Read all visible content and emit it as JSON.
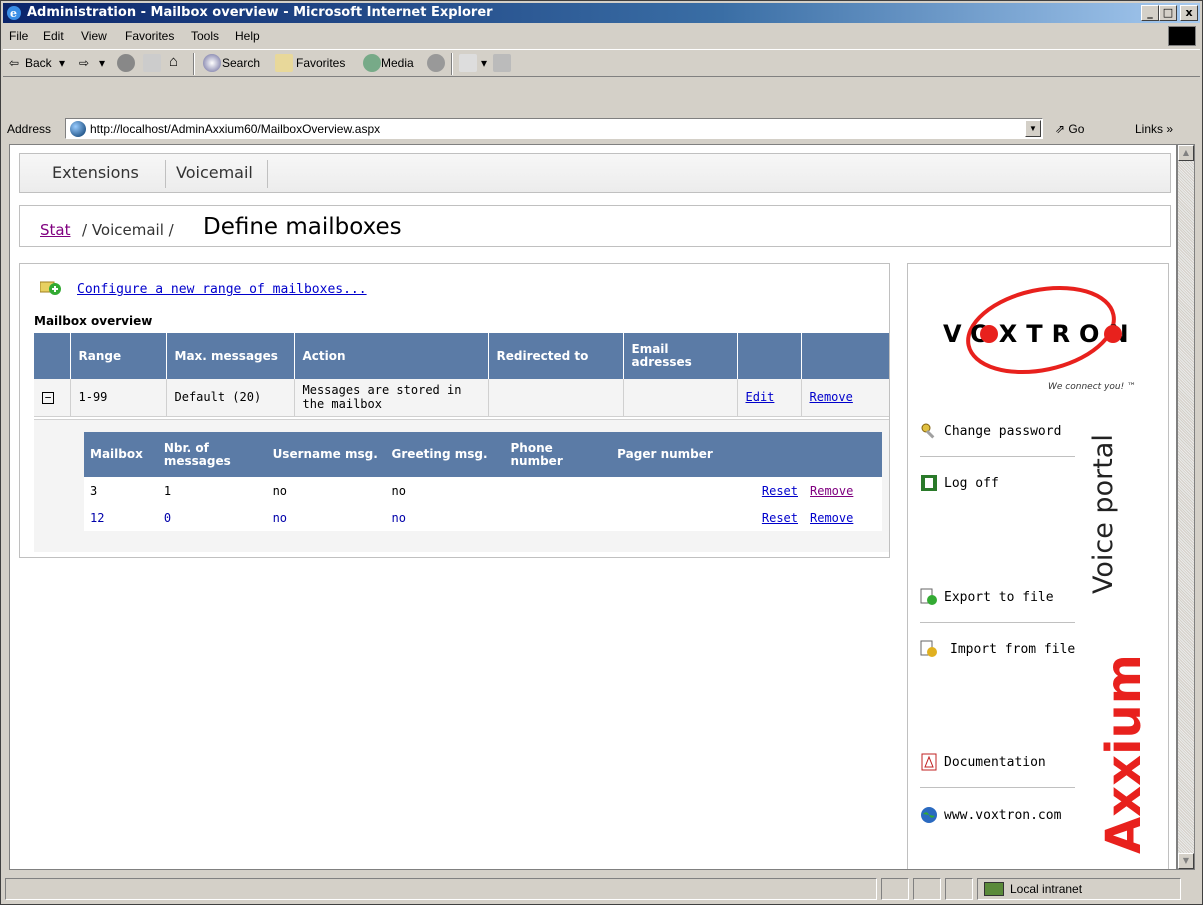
{
  "window": {
    "title": "Administration - Mailbox overview - Microsoft Internet Explorer",
    "min_label": "_",
    "max_label": "□",
    "close_label": "x"
  },
  "menu": [
    "File",
    "Edit",
    "View",
    "Favorites",
    "Tools",
    "Help"
  ],
  "toolbar": {
    "back": "Back",
    "search": "Search",
    "favorites": "Favorites",
    "media": "Media"
  },
  "address": {
    "label": "Address",
    "url": "http://localhost/AdminAxxium60/MailboxOverview.aspx",
    "go": "Go",
    "links": "Links »"
  },
  "tabs": [
    "Extensions",
    "Voicemail"
  ],
  "breadcrumb": {
    "start": "Stat",
    "middle": "/ Voicemail /",
    "title": "Define mailboxes"
  },
  "configure_link": "Configure a new range of mailboxes...",
  "overview_title": "Mailbox overview",
  "outer_table": {
    "headers": [
      "Range",
      "Max. messages",
      "Action",
      "Redirected to",
      "Email adresses"
    ],
    "row": {
      "toggle": "−",
      "range": "1-99",
      "max": "Default (20)",
      "action": "Messages are stored in the mailbox",
      "redirected": "",
      "email": "",
      "edit": "Edit",
      "remove": "Remove"
    }
  },
  "inner_table": {
    "headers": [
      "Mailbox",
      "Nbr. of messages",
      "Username msg.",
      "Greeting msg.",
      "Phone number",
      "Pager number"
    ],
    "rows": [
      {
        "mailbox": "3",
        "count": "1",
        "username": "no",
        "greeting": "no",
        "phone": "",
        "pager": "",
        "reset": "Reset",
        "remove": "Remove"
      },
      {
        "mailbox": "12",
        "count": "0",
        "username": "no",
        "greeting": "no",
        "phone": "",
        "pager": "",
        "reset": "Reset",
        "remove": "Remove"
      }
    ]
  },
  "side": {
    "brand": "VOXTRON",
    "tagline": "We connect you! ™",
    "items": {
      "change_password": "Change password",
      "log_off": "Log off",
      "export": "Export to file",
      "import": "Import from file",
      "documentation": "Documentation",
      "website": "www.voxtron.com"
    },
    "product": "Axxium",
    "portal": "Voice portal"
  },
  "status": {
    "zone": "Local intranet"
  },
  "colors": {
    "header_bg": "#5b7ba6",
    "brand_red": "#e8211d",
    "link": "#0000cc",
    "visited": "#800080"
  }
}
